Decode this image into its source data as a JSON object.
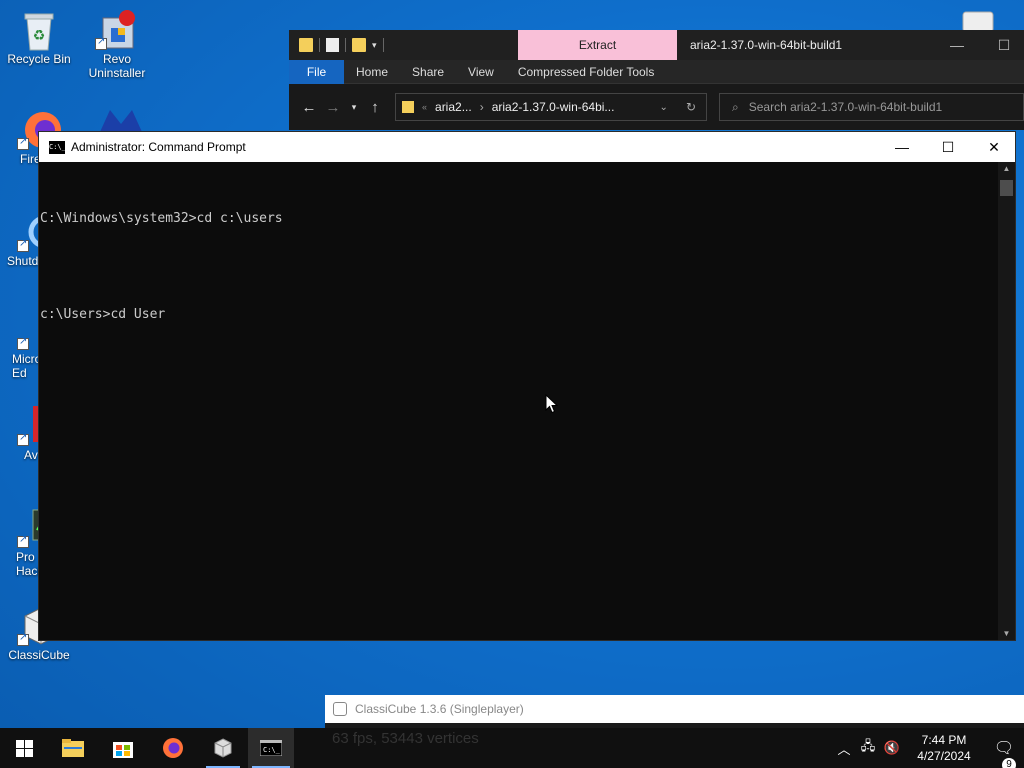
{
  "desktop": {
    "icons": [
      {
        "label": "Recycle Bin",
        "icon": "recycle-bin-icon"
      },
      {
        "label": "Revo\nUninstaller",
        "icon": "revo-uninstaller-icon"
      },
      {
        "label": "Fire",
        "icon": "firefox-icon"
      },
      {
        "label": "Shutd",
        "icon": "shutdown-icon"
      },
      {
        "label": "Micro\nEd",
        "icon": "edge-icon"
      },
      {
        "label": "Av",
        "icon": "avast-icon"
      },
      {
        "label": "Pro\nHack",
        "icon": "process-hacker-icon"
      },
      {
        "label": "ClassiCube",
        "icon": "classicube-icon"
      }
    ]
  },
  "explorer": {
    "context_tab": "Extract",
    "title": "aria2-1.37.0-win-64bit-build1",
    "ribbon_tabs": [
      "File",
      "Home",
      "Share",
      "View",
      "Compressed Folder Tools"
    ],
    "breadcrumb": [
      "aria2...",
      "aria2-1.37.0-win-64bi..."
    ],
    "search_placeholder": "Search aria2-1.37.0-win-64bit-build1"
  },
  "cmd": {
    "title": "Administrator: Command Prompt",
    "icon_text": "C:\\_",
    "lines": [
      "C:\\Windows\\system32>cd c:\\users",
      "",
      "c:\\Users>cd User"
    ]
  },
  "classicube": {
    "title": "ClassiCube 1.3.6 (Singleplayer)",
    "status_text": "63 fps, 53443 vertices"
  },
  "taskbar": {
    "items": [
      "start-icon",
      "file-explorer-icon",
      "store-icon",
      "firefox-icon",
      "classicube-icon",
      "command-prompt-icon"
    ],
    "clock_time": "7:44 PM",
    "clock_date": "4/27/2024",
    "notification_count": "9"
  },
  "colors": {
    "accent": "#1565c0",
    "extract_tab": "#f9c0d8",
    "console_bg": "#0c0c0c",
    "console_fg": "#cccccc"
  }
}
